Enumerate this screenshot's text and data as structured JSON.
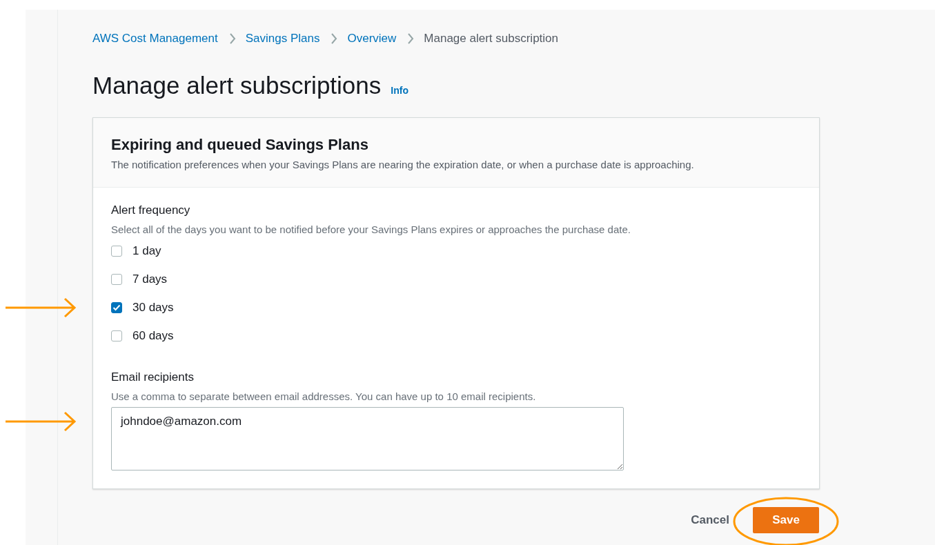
{
  "breadcrumbs": [
    {
      "label": "AWS Cost Management",
      "kind": "link"
    },
    {
      "label": "Savings Plans",
      "kind": "link"
    },
    {
      "label": "Overview",
      "kind": "link"
    },
    {
      "label": "Manage alert subscription",
      "kind": "current"
    }
  ],
  "page_title": "Manage alert subscriptions",
  "info_link": "Info",
  "card": {
    "title": "Expiring and queued Savings Plans",
    "description": "The notification preferences when your Savings Plans are nearing the expiration date, or when a purchase date is approaching."
  },
  "alert_frequency": {
    "label": "Alert frequency",
    "description": "Select all of the days you want to be notified before your Savings Plans expires or approaches the purchase date.",
    "options": [
      {
        "label": "1 day",
        "checked": false
      },
      {
        "label": "7 days",
        "checked": false
      },
      {
        "label": "30 days",
        "checked": true
      },
      {
        "label": "60 days",
        "checked": false
      }
    ]
  },
  "email_recipients": {
    "label": "Email recipients",
    "description": "Use a comma to separate between email addresses. You can have up to 10 email recipients.",
    "value": "johndoe@amazon.com"
  },
  "buttons": [
    {
      "label": "Cancel",
      "kind": "link"
    },
    {
      "label": "Save",
      "kind": "primary"
    }
  ]
}
